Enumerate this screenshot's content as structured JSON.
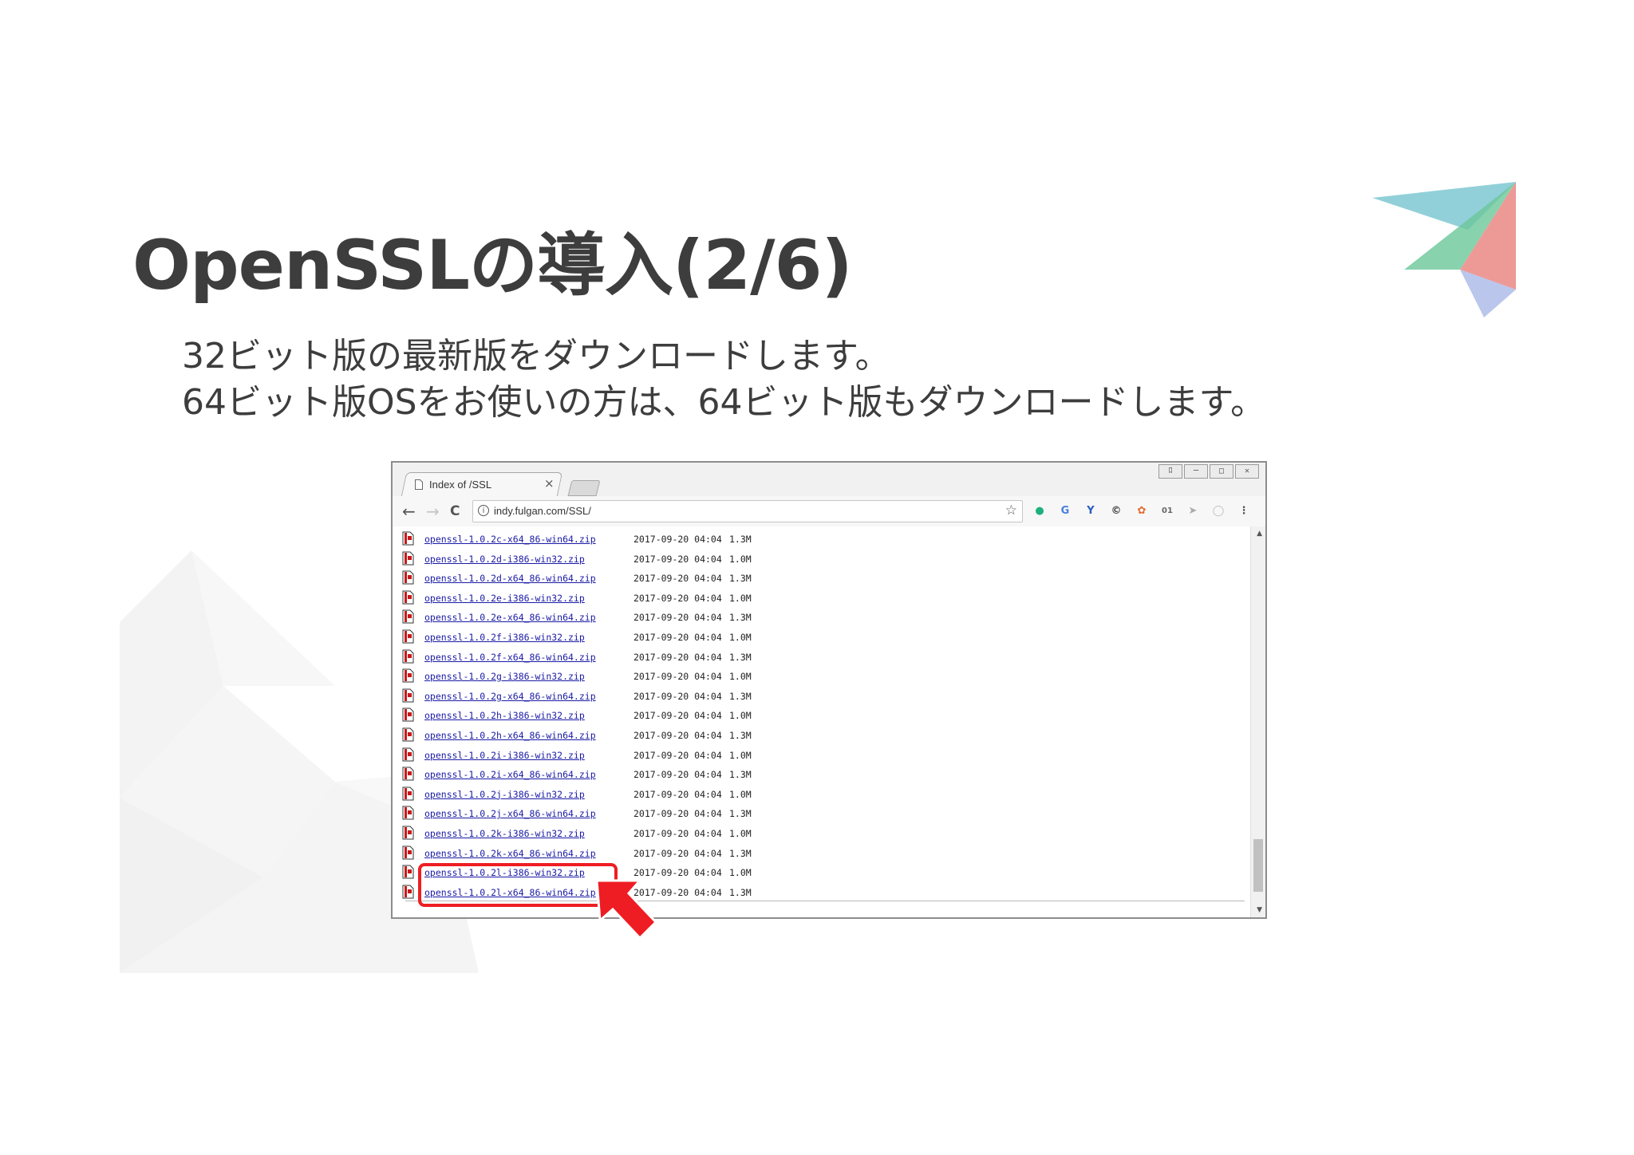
{
  "slide": {
    "title": "OpenSSLの導入(2/6)",
    "body_lines": [
      "32ビット版の最新版をダウンロードします。",
      "64ビット版OSをお使いの方は、64ビット版もダウンロードします。"
    ]
  },
  "browser": {
    "tab_title": "Index of /SSL",
    "tab_close": "×",
    "url": "indy.fulgan.com/SSL/",
    "window_buttons": [
      "ﾛ",
      "─",
      "□",
      "✕"
    ],
    "nav": {
      "back": "←",
      "forward": "→",
      "reload": "C"
    },
    "bookmark": "☆",
    "menu": "⋮"
  },
  "listing": [
    {
      "name": "openssl-1.0.2c-x64_86-win64.zip",
      "date": "2017-09-20 04:04",
      "size": "1.3M"
    },
    {
      "name": "openssl-1.0.2d-i386-win32.zip",
      "date": "2017-09-20 04:04",
      "size": "1.0M"
    },
    {
      "name": "openssl-1.0.2d-x64_86-win64.zip",
      "date": "2017-09-20 04:04",
      "size": "1.3M"
    },
    {
      "name": "openssl-1.0.2e-i386-win32.zip",
      "date": "2017-09-20 04:04",
      "size": "1.0M"
    },
    {
      "name": "openssl-1.0.2e-x64_86-win64.zip",
      "date": "2017-09-20 04:04",
      "size": "1.3M"
    },
    {
      "name": "openssl-1.0.2f-i386-win32.zip",
      "date": "2017-09-20 04:04",
      "size": "1.0M"
    },
    {
      "name": "openssl-1.0.2f-x64_86-win64.zip",
      "date": "2017-09-20 04:04",
      "size": "1.3M"
    },
    {
      "name": "openssl-1.0.2g-i386-win32.zip",
      "date": "2017-09-20 04:04",
      "size": "1.0M"
    },
    {
      "name": "openssl-1.0.2g-x64_86-win64.zip",
      "date": "2017-09-20 04:04",
      "size": "1.3M"
    },
    {
      "name": "openssl-1.0.2h-i386-win32.zip",
      "date": "2017-09-20 04:04",
      "size": "1.0M"
    },
    {
      "name": "openssl-1.0.2h-x64_86-win64.zip",
      "date": "2017-09-20 04:04",
      "size": "1.3M"
    },
    {
      "name": "openssl-1.0.2i-i386-win32.zip",
      "date": "2017-09-20 04:04",
      "size": "1.0M"
    },
    {
      "name": "openssl-1.0.2i-x64_86-win64.zip",
      "date": "2017-09-20 04:04",
      "size": "1.3M"
    },
    {
      "name": "openssl-1.0.2j-i386-win32.zip",
      "date": "2017-09-20 04:04",
      "size": "1.0M"
    },
    {
      "name": "openssl-1.0.2j-x64_86-win64.zip",
      "date": "2017-09-20 04:04",
      "size": "1.3M"
    },
    {
      "name": "openssl-1.0.2k-i386-win32.zip",
      "date": "2017-09-20 04:04",
      "size": "1.0M"
    },
    {
      "name": "openssl-1.0.2k-x64_86-win64.zip",
      "date": "2017-09-20 04:04",
      "size": "1.3M"
    },
    {
      "name": "openssl-1.0.2l-i386-win32.zip",
      "date": "2017-09-20 04:04",
      "size": "1.0M"
    },
    {
      "name": "openssl-1.0.2l-x64_86-win64.zip",
      "date": "2017-09-20 04:04",
      "size": "1.3M"
    }
  ],
  "colors": {
    "highlight": "#ee1d23",
    "link": "#1a1aa6",
    "title_text": "#3d3d3d"
  }
}
